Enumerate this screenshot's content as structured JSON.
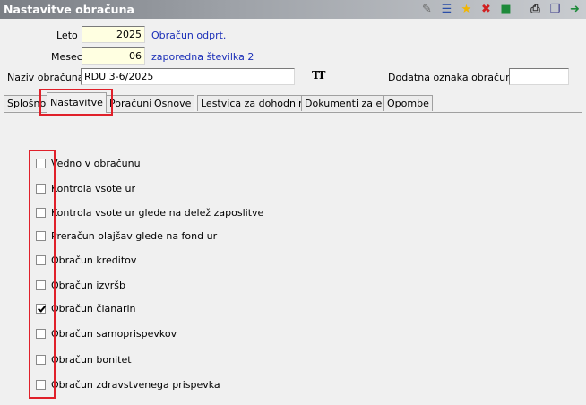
{
  "window": {
    "title": "Nastavitve obračuna"
  },
  "toolbar": {
    "icons": [
      "edit-icon",
      "list-icon",
      "star-icon",
      "delete-icon",
      "cube-icon",
      "print-icon",
      "copy-icon",
      "exit-icon"
    ]
  },
  "form": {
    "leto": {
      "label": "Leto",
      "value": "2025",
      "note": "Obračun odprt."
    },
    "mesec": {
      "label": "Mesec",
      "value": "06",
      "note": "zaporedna številka 2"
    },
    "naziv": {
      "label": "Naziv obračuna",
      "value": "RDU 3-6/2025"
    },
    "dodatna": {
      "label": "Dodatna oznaka obračuna",
      "value": ""
    }
  },
  "tabs": [
    {
      "label": "Splošno"
    },
    {
      "label": "Nastavitve"
    },
    {
      "label": "Poračuni"
    },
    {
      "label": "Osnove"
    },
    {
      "label": "Lestvica za dohodnino"
    },
    {
      "label": "Dokumenti za eR"
    },
    {
      "label": "Opombe"
    }
  ],
  "active_tab": "Nastavitve",
  "options": [
    {
      "label": "Vedno v obračunu",
      "checked": false
    },
    {
      "label": "Kontrola vsote ur",
      "checked": false
    },
    {
      "label": "Kontrola vsote ur glede na delež zaposlitve",
      "checked": false
    },
    {
      "label": "Preračun olajšav glede na fond ur",
      "checked": false
    },
    {
      "label": "Obračun kreditov",
      "checked": false
    },
    {
      "label": "Obračun izvršb",
      "checked": false
    },
    {
      "label": "Obračun članarin",
      "checked": true
    },
    {
      "label": "Obračun samoprispevkov",
      "checked": false
    },
    {
      "label": "Obračun bonitet",
      "checked": false
    },
    {
      "label": "Obračun zdravstvenega prispevka",
      "checked": false
    }
  ],
  "colors": {
    "highlight": "#e0202a",
    "link": "#1a2eb8",
    "input_yellow": "#ffffe1"
  }
}
